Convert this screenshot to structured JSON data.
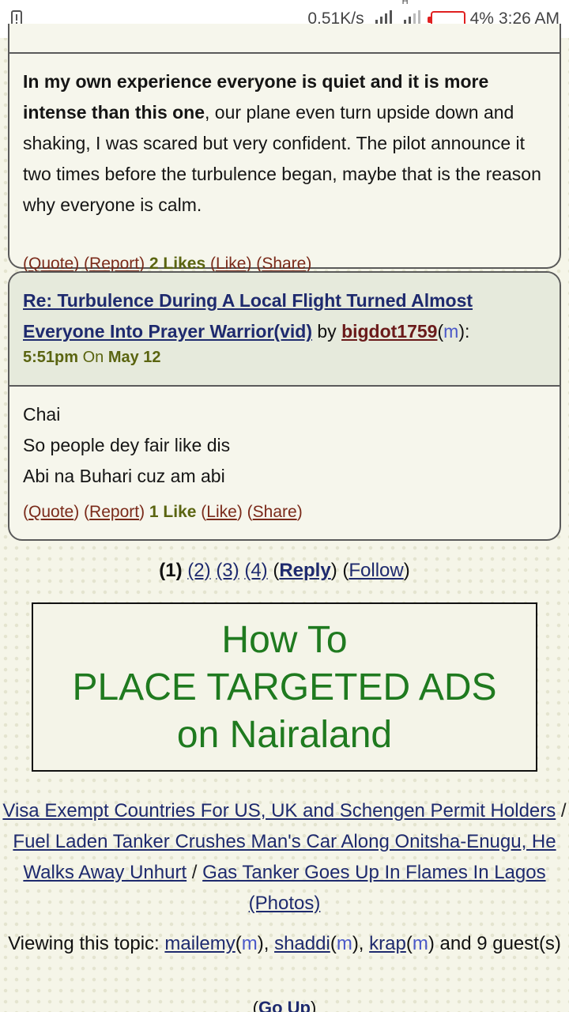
{
  "status_bar": {
    "speed": "0.51K/s",
    "network": "H",
    "battery": "4%",
    "time": "3:26 AM"
  },
  "post1": {
    "bold_text": "In my own experience everyone is quiet and it is more intense than this one",
    "rest_text": ", our plane even turn upside down and shaking, I was scared but very confident. The pilot announce it two times before the turbulence began, maybe that is the reason why everyone is calm.",
    "actions": {
      "quote": "Quote",
      "report": "Report",
      "likes": "2 Likes",
      "like": "Like",
      "share": "Share"
    }
  },
  "post2": {
    "title": "Re: Turbulence During A Local Flight Turned Almost Everyone Into Prayer Warrior(vid)",
    "by": "by",
    "username": "bigdot1759",
    "gender": "m",
    "time": "5:51pm",
    "on": "On",
    "date": "May 12",
    "lines": [
      "Chai",
      "So people dey fair like dis",
      "Abi na Buhari cuz am abi"
    ],
    "actions": {
      "quote": "Quote",
      "report": "Report",
      "likes": "1 Like",
      "like": "Like",
      "share": "Share"
    }
  },
  "pagination": {
    "current": "(1)",
    "pages": [
      "(2)",
      "(3)",
      "(4)"
    ],
    "reply": "Reply",
    "follow": "Follow"
  },
  "ad": {
    "lines": [
      "How To",
      "PLACE TARGETED ADS",
      "on Nairaland"
    ],
    "color": "#1f7a1f"
  },
  "related": [
    "Visa Exempt Countries For US, UK and Schengen Permit Holders",
    "Fuel Laden Tanker Crushes Man's Car Along Onitsha-Enugu, He Walks Away Unhurt",
    "Gas Tanker Goes Up In Flames In Lagos (Photos)"
  ],
  "viewing": {
    "prefix": "Viewing this topic:",
    "users": [
      {
        "name": "mailemy",
        "gender": "m"
      },
      {
        "name": "shaddi",
        "gender": "m"
      },
      {
        "name": "krap",
        "gender": "m"
      }
    ],
    "suffix": "and 9 guest(s)"
  },
  "go_up": "Go Up"
}
